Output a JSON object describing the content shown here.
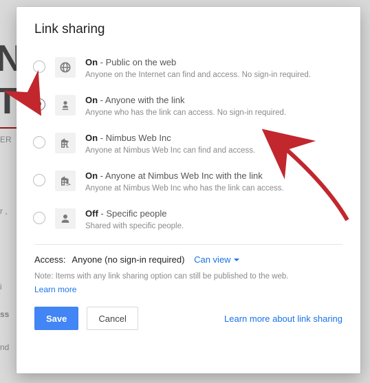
{
  "dialog": {
    "title": "Link sharing",
    "options": [
      {
        "bold": "On",
        "label": " - Public on the web",
        "desc": "Anyone on the Internet can find and access. No sign-in required."
      },
      {
        "bold": "On",
        "label": " - Anyone with the link",
        "desc": "Anyone who has the link can access. No sign-in required."
      },
      {
        "bold": "On",
        "label": " - Nimbus Web Inc",
        "desc": "Anyone at Nimbus Web Inc can find and access."
      },
      {
        "bold": "On",
        "label": " - Anyone at Nimbus Web Inc with the link",
        "desc": "Anyone at Nimbus Web Inc who has the link can access."
      },
      {
        "bold": "Off",
        "label": " - Specific people",
        "desc": "Shared with specific people."
      }
    ],
    "access": {
      "label": "Access:",
      "value": "Anyone (no sign-in required)",
      "dropdown": "Can view"
    },
    "note": "Note: Items with any link sharing option can still be published to the web.",
    "learn_more": "Learn more",
    "buttons": {
      "save": "Save",
      "cancel": "Cancel"
    },
    "footer_link": "Learn more about link sharing"
  }
}
